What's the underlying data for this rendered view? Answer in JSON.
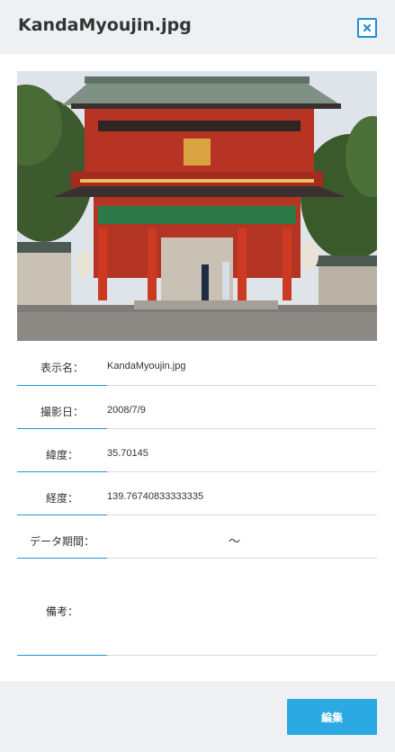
{
  "dialog": {
    "title": "KandaMyoujin.jpg"
  },
  "fields": [
    {
      "label": "表示名：",
      "value": "KandaMyoujin.jpg"
    },
    {
      "label": "撮影日：",
      "value": "2008/7/9"
    },
    {
      "label": "緯度：",
      "value": "35.70145"
    },
    {
      "label": "経度：",
      "value": "139.76740833333335"
    },
    {
      "label": "データ期間：",
      "value": "",
      "separator": "〜"
    },
    {
      "label": "備考：",
      "value": ""
    }
  ],
  "footer": {
    "edit_label": "編集"
  },
  "colors": {
    "accent": "#2196d3",
    "button": "#2aa9e2",
    "header_bg": "#eef0f3"
  },
  "icons": {
    "close": "close-icon"
  }
}
